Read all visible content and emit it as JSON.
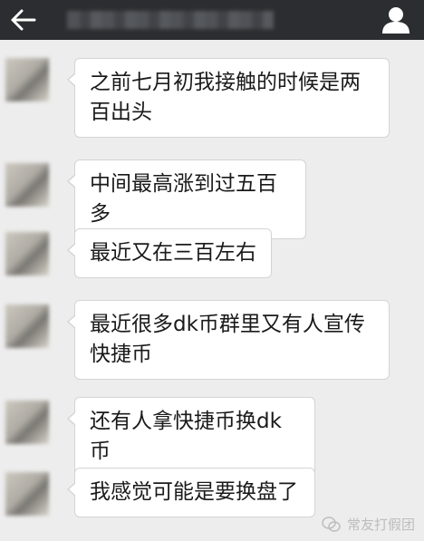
{
  "header": {
    "back_icon": "back-arrow-icon",
    "profile_icon": "person-icon"
  },
  "messages": [
    {
      "text": "之前七月初我接触的时候是两百出头"
    },
    {
      "text": "中间最高涨到过五百多"
    },
    {
      "text": "最近又在三百左右"
    },
    {
      "text": "最近很多dk币群里又有人宣传快捷币"
    },
    {
      "text": "还有人拿快捷币换dk币"
    },
    {
      "text": "我感觉可能是要换盘了"
    }
  ],
  "watermark": {
    "text": "常友打假团",
    "icon": "wechat-icon"
  },
  "colors": {
    "topbar": "#2b2d30",
    "background": "#ededed",
    "bubble": "#ffffff"
  }
}
